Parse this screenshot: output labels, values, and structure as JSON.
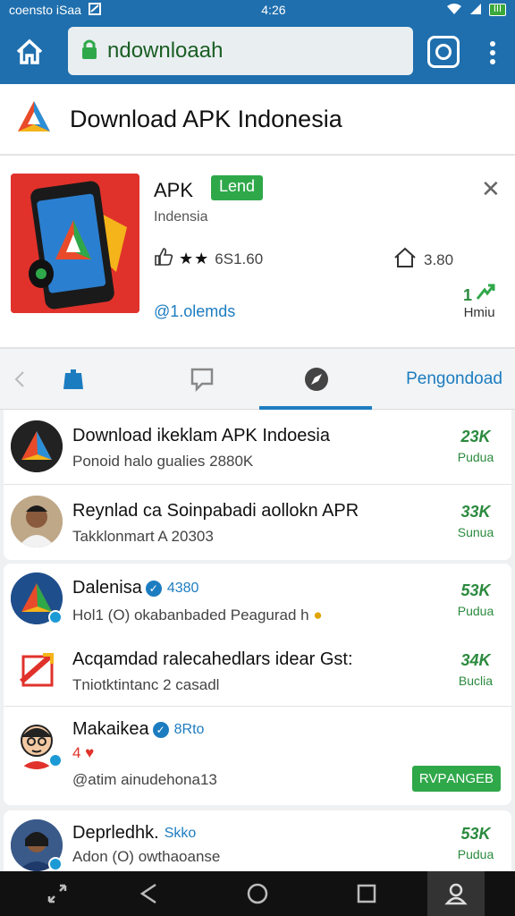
{
  "status_bar": {
    "left_text": "сoensto iSaa",
    "time": "4:26",
    "battery": "III"
  },
  "browser": {
    "url_text": "ndownloaah"
  },
  "site": {
    "title": "Download APK Indonesia"
  },
  "app": {
    "name": "APK",
    "badge": "Lend",
    "subtitle": "Indensia",
    "rating_text": "6S1.60",
    "size_text": "3.80",
    "link_text": "@1.olemds",
    "rank_num": "1",
    "rank_label": "Hmiu"
  },
  "tabs": {
    "active_label": "Pengondoad"
  },
  "list": [
    {
      "title": "Download ikeklam APK Indoesia",
      "subtitle": "Ponoid halo gualies 2880K",
      "count": "23K",
      "count_label": "Pudua"
    },
    {
      "title": "Reynlad ca Soinpabadi aollokn APR",
      "subtitle": "Takklonmart A 20303",
      "count": "33K",
      "count_label": "Sunua"
    },
    {
      "title": "Dalenisa",
      "handle": "4380",
      "subtitle": "Hol1 (O) okabanbaded Peagurad h",
      "count": "53K",
      "count_label": "Pudua"
    },
    {
      "title": "Acqamdad ralecahedlars idear Gst:",
      "subtitle": "Tniotktintanc 2 casadl",
      "count": "34K",
      "count_label": "Buclia"
    },
    {
      "title": "Makaikea",
      "handle": "8Rto",
      "subtitle": "@atim ainudehona13",
      "reactions": "4 ♥",
      "button": "RVPАNGEB"
    },
    {
      "title": "Deprledhk.",
      "handle": "Skko",
      "subtitle": "Adon (O) owthaoanse",
      "count": "53K",
      "count_label": "Pudua"
    }
  ]
}
